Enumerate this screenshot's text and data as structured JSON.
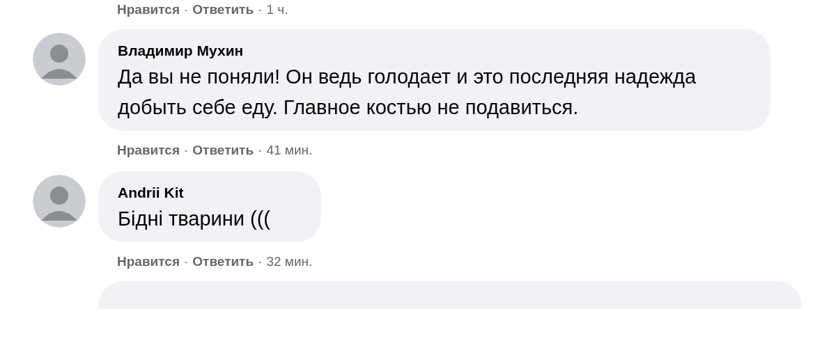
{
  "previous_actions": {
    "like": "Нравится",
    "separator_1": "·",
    "reply": "Ответить",
    "separator_2": "·",
    "time": "1 ч."
  },
  "comments": [
    {
      "author": "Владимир Мухин",
      "text": "Да вы не поняли! Он ведь голодает и это последняя надежда добыть себе еду. Главное костью не подавиться.",
      "actions": {
        "like": "Нравится",
        "separator_1": "·",
        "reply": "Ответить",
        "separator_2": "·",
        "time": "41 мин."
      }
    },
    {
      "author": "Andrii Kit",
      "text": "Бідні тварини (((",
      "actions": {
        "like": "Нравится",
        "separator_1": "·",
        "reply": "Ответить",
        "separator_2": "·",
        "time": "32 мин."
      }
    }
  ]
}
